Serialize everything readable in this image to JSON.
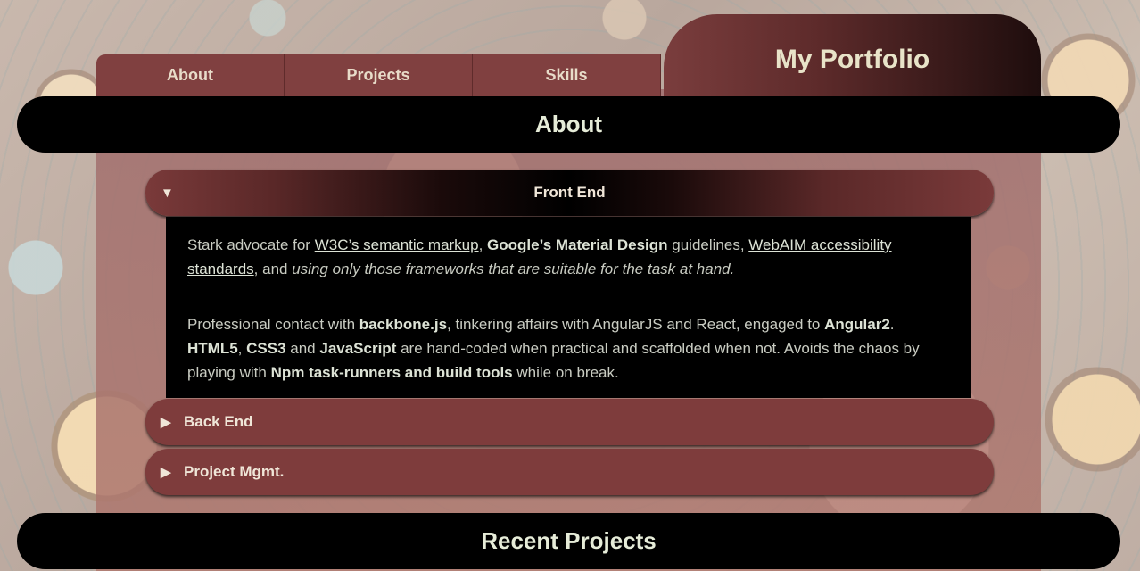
{
  "nav": {
    "tabs": [
      {
        "label": "About"
      },
      {
        "label": "Projects"
      },
      {
        "label": "Skills"
      }
    ],
    "brand_title": "My Portfolio"
  },
  "sections": {
    "about_title": "About",
    "recent_projects_title": "Recent Projects"
  },
  "accordion": {
    "front_end": {
      "label": "Front End",
      "arrow": "▼",
      "p1": {
        "t1": "Stark advocate for ",
        "link1": "W3C’s semantic markup",
        "t2": ", ",
        "b1": "Google’s Material Design",
        "t3": " guidelines, ",
        "link2": "WebAIM accessibility standards",
        "t4": ", and ",
        "i1": "using only those frameworks that are suitable for the task at hand."
      },
      "p2": {
        "t1": "Professional contact with ",
        "b1": "backbone.js",
        "t2": ", tinkering affairs with AngularJS and React, engaged to ",
        "b2": "Angular2",
        "t3": ". ",
        "b3": "HTML5",
        "t4": ", ",
        "b4": "CSS3",
        "t5": " and ",
        "b5": "JavaScript",
        "t6": " are hand-coded when practical and scaffolded when not. Avoids the chaos by playing with ",
        "b6": "Npm task-runners and build tools",
        "t7": " while on break."
      }
    },
    "back_end": {
      "label": "Back End",
      "arrow": "▶"
    },
    "project_mgmt": {
      "label": "Project Mgmt.",
      "arrow": "▶"
    }
  },
  "colors": {
    "accent": "#804040",
    "bar": "#000000",
    "title_text": "#e8e3c8"
  }
}
